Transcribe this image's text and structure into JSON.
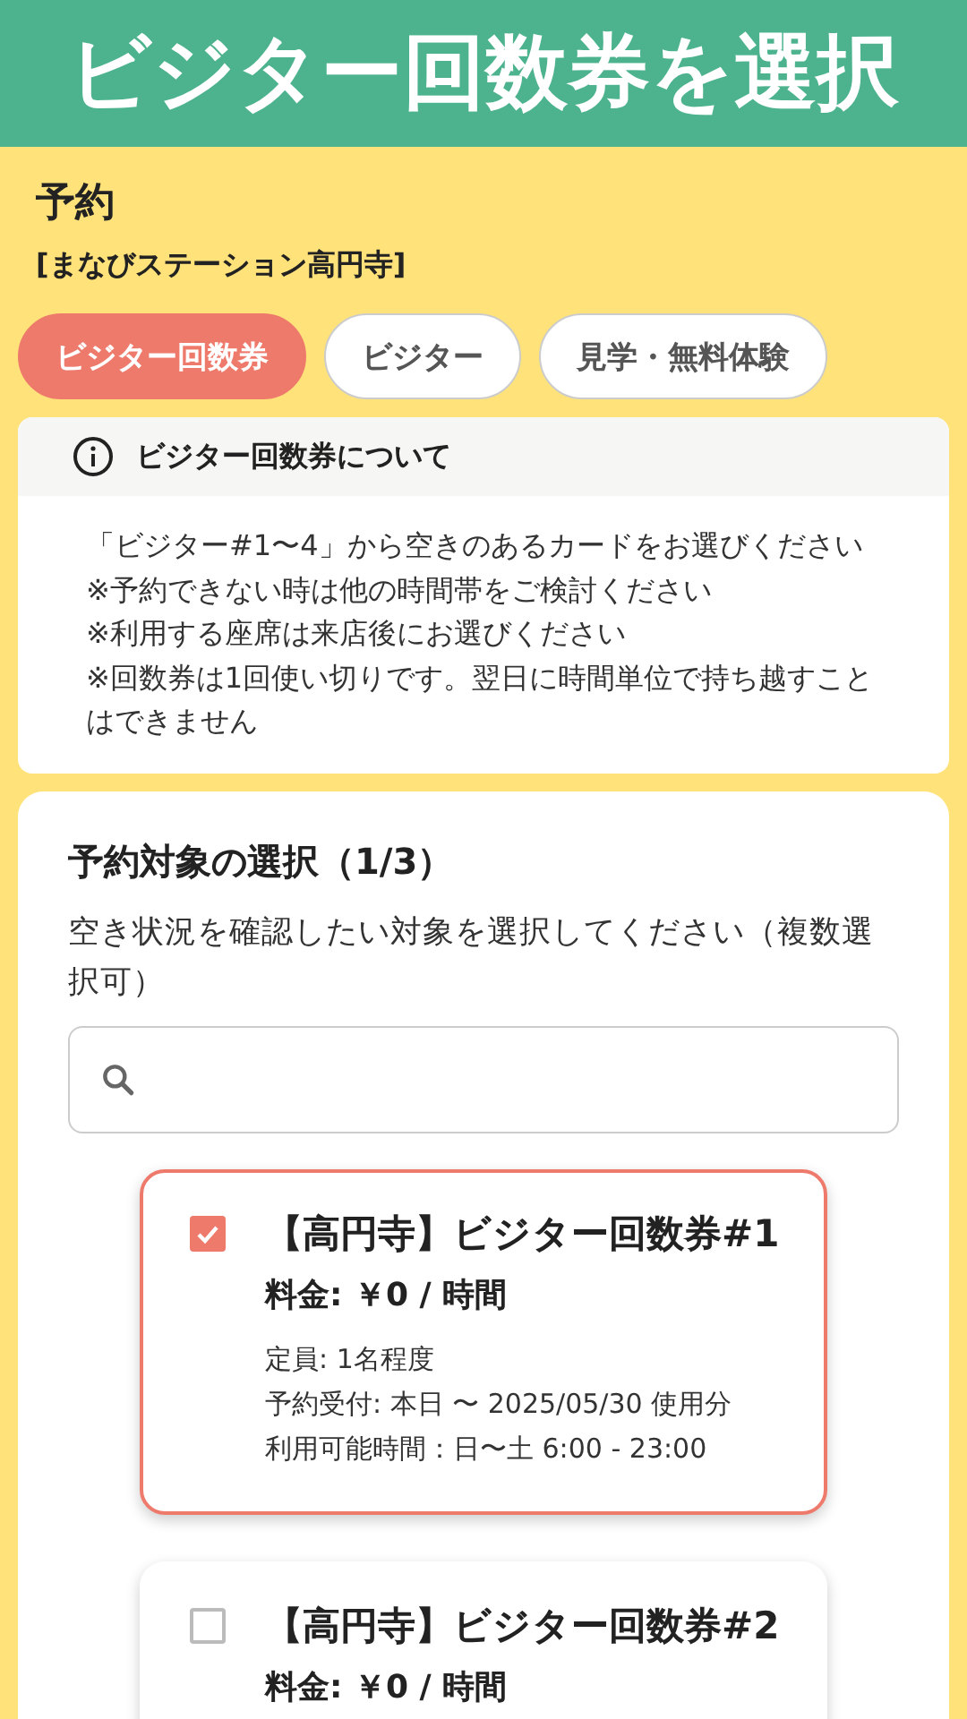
{
  "header": {
    "title": "ビジター回数券を選択"
  },
  "page": {
    "heading": "予約",
    "location": "[まなびステーション高円寺]"
  },
  "tabs": [
    {
      "label": "ビジター回数券",
      "selected": true
    },
    {
      "label": "ビジター",
      "selected": false
    },
    {
      "label": "見学・無料体験",
      "selected": false
    }
  ],
  "info": {
    "title": "ビジター回数券について",
    "lines": [
      "「ビジター#1〜4」から空きのあるカードをお選びください",
      "※予約できない時は他の時間帯をご検討ください",
      "※利用する座席は来店後にお選びください",
      "※回数券は1回使い切りです。翌日に時間単位で持ち越すことはできません"
    ]
  },
  "selection": {
    "title": "予約対象の選択（1/3）",
    "description": "空き状況を確認したい対象を選択してください（複数選択可）",
    "search": {
      "kind": "search"
    },
    "items": [
      {
        "name": "【高円寺】ビジター回数券#1",
        "price": "料金: ￥0 / 時間",
        "details": [
          "定員: 1名程度",
          "予約受付: 本日 〜 2025/05/30 使用分",
          "利用可能時間：日〜土 6:00 - 23:00"
        ],
        "checked": true
      },
      {
        "name": "【高円寺】ビジター回数券#2",
        "price": "料金: ￥0 / 時間",
        "checked": false
      }
    ]
  }
}
